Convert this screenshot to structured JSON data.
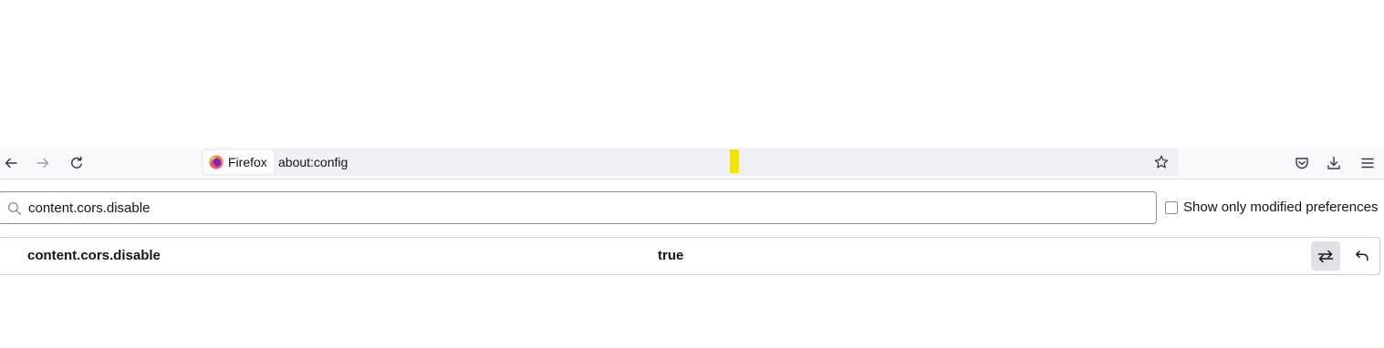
{
  "toolbar": {
    "identity_label": "Firefox",
    "url": "about:config"
  },
  "icons": {
    "back": "back-arrow-icon",
    "forward": "forward-arrow-icon",
    "reload": "reload-icon",
    "firefox": "firefox-logo-icon",
    "bookmark": "star-icon",
    "pocket": "pocket-icon",
    "downloads": "download-icon",
    "menu": "hamburger-menu-icon",
    "search": "search-icon",
    "toggle": "toggle-icon",
    "reset": "reset-icon"
  },
  "colors": {
    "highlight": "#f2e600",
    "toolbar_bg": "#f9f9fb",
    "urlbar_bg": "#f0f0f4"
  },
  "config": {
    "search_value": "content.cors.disable",
    "show_modified_label": "Show only modified preferences",
    "show_modified_checked": false,
    "preferences": [
      {
        "name": "content.cors.disable",
        "value": "true"
      }
    ]
  }
}
